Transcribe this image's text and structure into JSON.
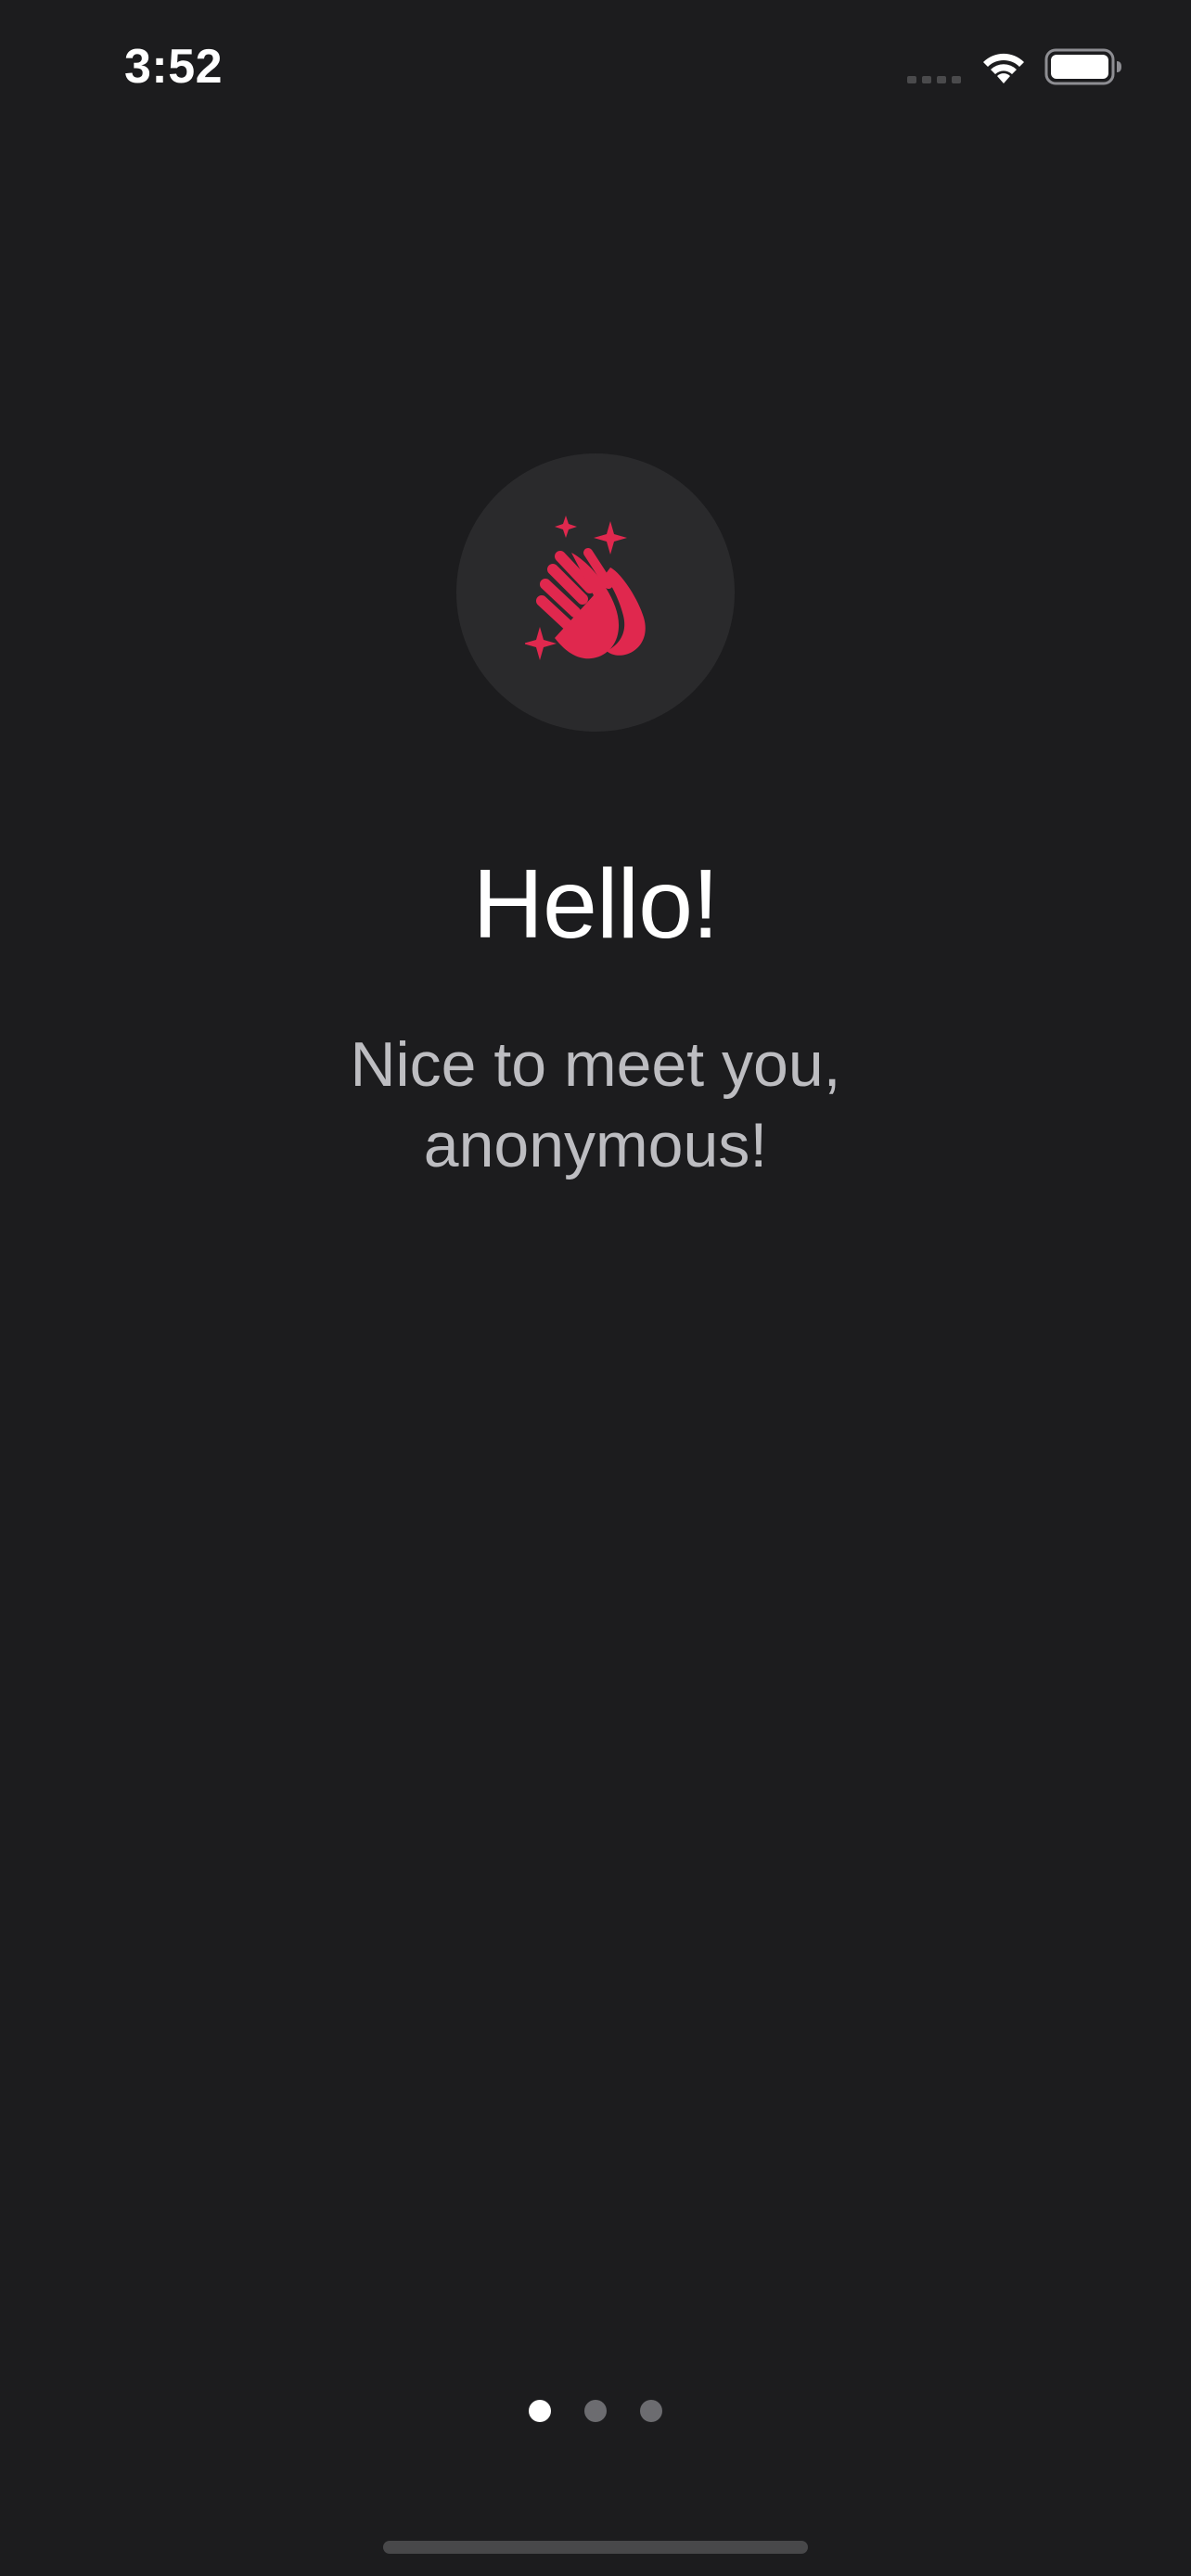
{
  "status_bar": {
    "time": "3:52"
  },
  "icons": {
    "hero": "hands-clapping-sparkles-icon",
    "signal": "cellular-signal-icon",
    "wifi": "wifi-icon",
    "battery": "battery-icon"
  },
  "colors": {
    "background": "#1c1c1e",
    "accent": "#e0284e",
    "hero_circle": "#2a2a2c"
  },
  "content": {
    "title": "Hello!",
    "subtitle": "Nice to meet you, anonymous!"
  },
  "page_control": {
    "current_page": 1,
    "total_pages": 3
  }
}
